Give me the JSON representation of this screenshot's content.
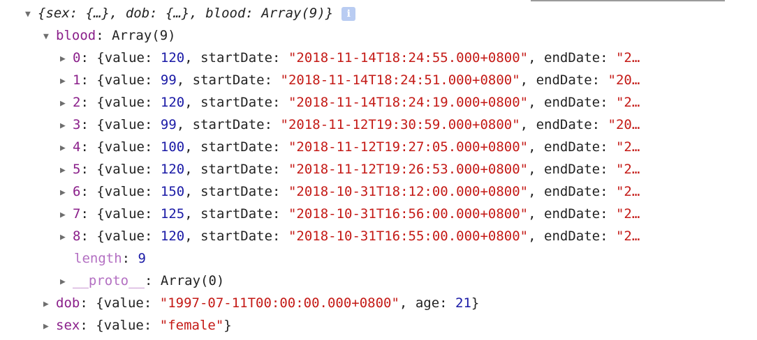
{
  "summary": {
    "text": "{sex: {…}, dob: {…}, blood: Array(9)}",
    "info_icon": "i"
  },
  "blood": {
    "key": "blood",
    "type": "Array(9)",
    "items": [
      {
        "index": "0",
        "value": "120",
        "startDate": "\"2018-11-14T18:24:55.000+0800\"",
        "endDate_preview": "\"2…"
      },
      {
        "index": "1",
        "value": "99",
        "startDate": "\"2018-11-14T18:24:51.000+0800\"",
        "endDate_preview": "\"20…"
      },
      {
        "index": "2",
        "value": "120",
        "startDate": "\"2018-11-14T18:24:19.000+0800\"",
        "endDate_preview": "\"2…"
      },
      {
        "index": "3",
        "value": "99",
        "startDate": "\"2018-11-12T19:30:59.000+0800\"",
        "endDate_preview": "\"20…"
      },
      {
        "index": "4",
        "value": "100",
        "startDate": "\"2018-11-12T19:27:05.000+0800\"",
        "endDate_preview": "\"2…"
      },
      {
        "index": "5",
        "value": "120",
        "startDate": "\"2018-11-12T19:26:53.000+0800\"",
        "endDate_preview": "\"2…"
      },
      {
        "index": "6",
        "value": "150",
        "startDate": "\"2018-10-31T18:12:00.000+0800\"",
        "endDate_preview": "\"2…"
      },
      {
        "index": "7",
        "value": "125",
        "startDate": "\"2018-10-31T16:56:00.000+0800\"",
        "endDate_preview": "\"2…"
      },
      {
        "index": "8",
        "value": "120",
        "startDate": "\"2018-10-31T16:55:00.000+0800\"",
        "endDate_preview": "\"2…"
      }
    ],
    "length_key": "length",
    "length_value": "9",
    "proto_key": "__proto__",
    "proto_value": "Array(0)"
  },
  "dob": {
    "key": "dob",
    "value": "\"1997-07-11T00:00:00.000+0800\"",
    "age": "21"
  },
  "sex": {
    "key": "sex",
    "value": "\"female\""
  },
  "labels": {
    "value_key": "value",
    "startDate_key": "startDate",
    "endDate_key": "endDate",
    "age_key": "age"
  }
}
